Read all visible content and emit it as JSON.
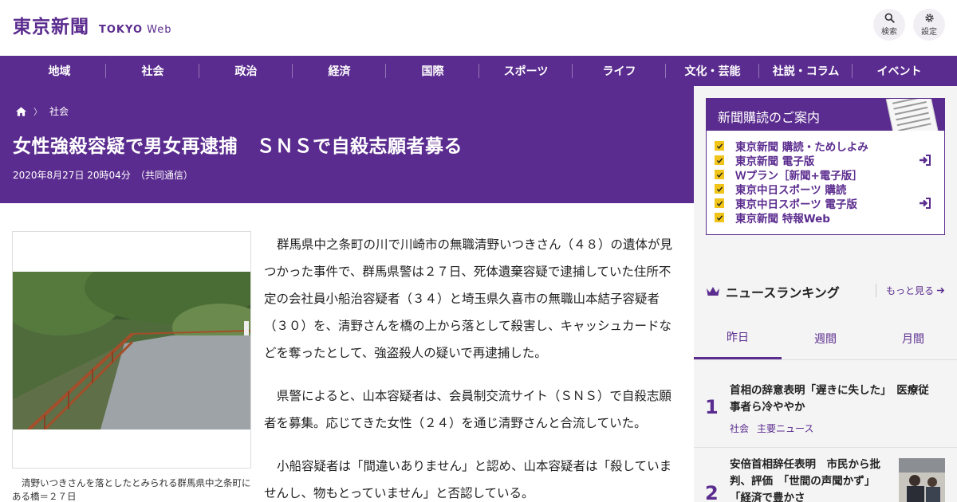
{
  "header": {
    "logo_jp": "東京新聞",
    "logo_en_bold": "TOKYO",
    "logo_en_light": "Web",
    "search_label": "検索",
    "settings_label": "設定"
  },
  "nav": {
    "items": [
      "地域",
      "社会",
      "政治",
      "経済",
      "国際",
      "スポーツ",
      "ライフ",
      "文化・芸能",
      "社説・コラム",
      "イベント"
    ]
  },
  "breadcrumb": {
    "home_icon": "home-icon",
    "category": "社会"
  },
  "article": {
    "title": "女性強殺容疑で男女再逮捕　ＳＮＳで自殺志願者募る",
    "date": "2020年8月27日 20時04分",
    "source": "（共同通信）",
    "photo_caption": "清野いつきさんを落としたとみられる群馬県中之条町にある橋＝２７日",
    "paragraphs": [
      "群馬県中之条町の川で川崎市の無職清野いつきさん（４８）の遺体が見つかった事件で、群馬県警は２７日、死体遺棄容疑で逮捕していた住所不定の会社員小船治容疑者（３４）と埼玉県久喜市の無職山本結子容疑者（３０）を、清野さんを橋の上から落として殺害し、キャッシュカードなどを奪ったとして、強盗殺人の疑いで再逮捕した。",
      "県警によると、山本容疑者は、会員制交流サイト（ＳＮＳ）で自殺志願者を募集。応じてきた女性（２４）を通じ清野さんと合流していた。",
      "小船容疑者は「間違いありません」と認め、山本容疑者は「殺していませんし、物もとっていません」と否認している。"
    ]
  },
  "subscription": {
    "heading": "新聞購読のご案内",
    "items": [
      {
        "label": "東京新聞 購読・ためしよみ",
        "login": false
      },
      {
        "label": "東京新聞 電子版",
        "login": true
      },
      {
        "label": "Ｗプラン［新聞+電子版］",
        "login": false
      },
      {
        "label": "東京中日スポーツ 購読",
        "login": false
      },
      {
        "label": "東京中日スポーツ 電子版",
        "login": true
      },
      {
        "label": "東京新聞 特報Web",
        "login": false
      }
    ]
  },
  "ranking": {
    "heading": "ニュースランキング",
    "more": "もっと見る",
    "tabs": [
      "昨日",
      "週間",
      "月間"
    ],
    "items": [
      {
        "rank": "1",
        "title_lines": [
          "首相の辞意表明「遅きに失した」　医療従",
          "事者ら冷ややか"
        ],
        "tags": [
          "社会",
          "主要ニュース"
        ]
      },
      {
        "rank": "2",
        "title_lines": [
          "安倍首相辞任表明　市民から批",
          "判、評価　「世間の声聞かず」",
          "「経済で豊かさ"
        ],
        "tags": []
      }
    ]
  },
  "colors": {
    "brand": "#5b2c8f",
    "check": "#f0c419",
    "sidebar_bg": "#f4f4f4"
  }
}
